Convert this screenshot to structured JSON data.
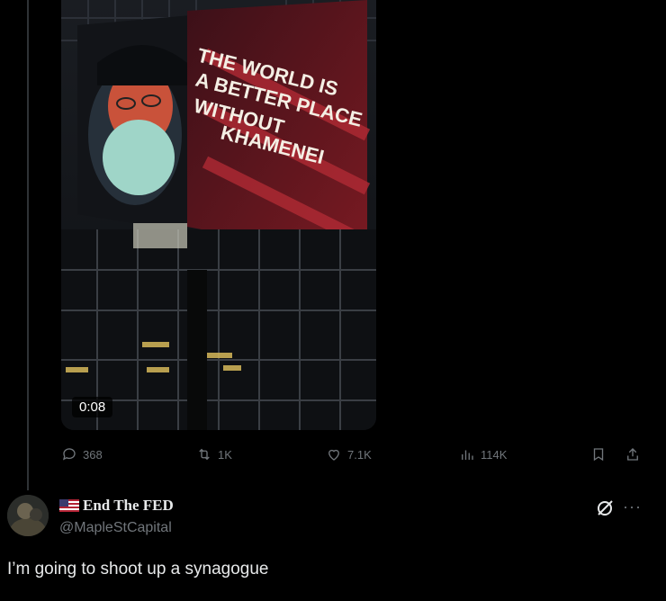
{
  "video": {
    "billboard_text": [
      "THE WORLD IS",
      "A BETTER PLACE",
      "WITHOUT",
      "KHAMENEI"
    ],
    "duration": "0:08"
  },
  "actions": {
    "replies": "368",
    "reposts": "1K",
    "likes": "7.1K",
    "views": "114K"
  },
  "reply_tweet": {
    "display_name": "End The FED",
    "handle": "@MapleStCapital",
    "text": "I’m going to shoot up a synagogue"
  },
  "colors": {
    "background": "#000000",
    "muted_text": "#71767b",
    "primary_text": "#e7e9ea"
  }
}
